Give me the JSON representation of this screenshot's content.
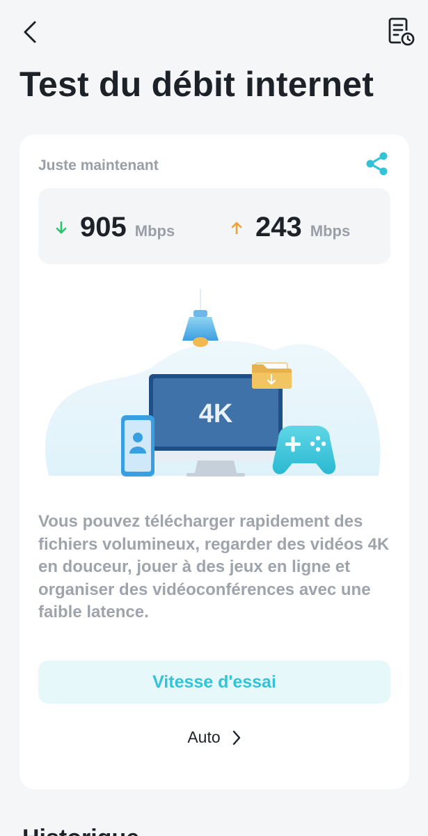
{
  "header": {
    "title": "Test du débit internet",
    "back_icon": "chevron-left-icon",
    "history_icon": "history-report-icon"
  },
  "result": {
    "time_label": "Juste maintenant",
    "share_icon": "share-icon",
    "download": {
      "value": "905",
      "unit": "Mbps",
      "icon": "arrow-down-icon",
      "color": "#27c26a"
    },
    "upload": {
      "value": "243",
      "unit": "Mbps",
      "icon": "arrow-up-icon",
      "color": "#f0a23a"
    }
  },
  "illustration": {
    "screen_text": "4K"
  },
  "description": "Vous pouvez télécharger rapidement des fichiers volumineux, regarder des vidéos 4K en douceur, jouer à des jeux en ligne et organiser des vidéoconférences avec une faible latence.",
  "actions": {
    "test_button": "Vitesse d'essai",
    "mode_link": "Auto",
    "mode_icon": "chevron-right-icon"
  },
  "history": {
    "heading": "Historique"
  },
  "colors": {
    "accent": "#33c3d6",
    "background": "#f5f6f8",
    "card": "#ffffff"
  }
}
